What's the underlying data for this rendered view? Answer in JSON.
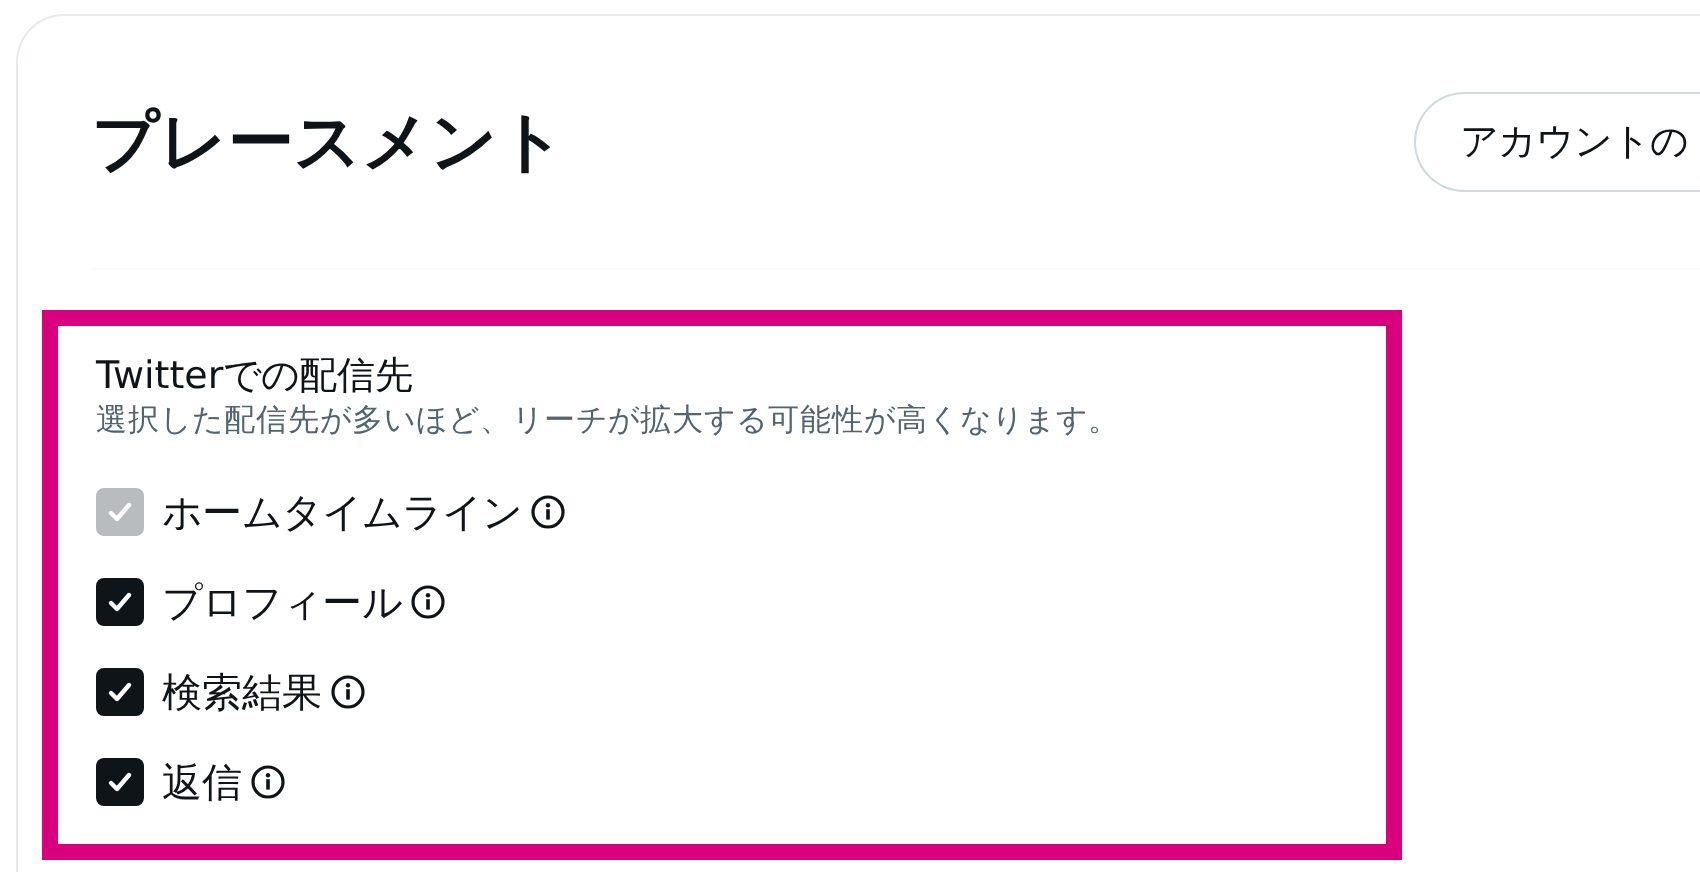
{
  "title": "プレースメント",
  "account_button": {
    "label": "アカウントの"
  },
  "placements": {
    "heading": "Twitterでの配信先",
    "description": "選択した配信先が多いほど、リーチが拡大する可能性が高くなります。",
    "options": [
      {
        "label": "ホームタイムライン",
        "checked": true,
        "disabled": true
      },
      {
        "label": "プロフィール",
        "checked": true,
        "disabled": false
      },
      {
        "label": "検索結果",
        "checked": true,
        "disabled": false
      },
      {
        "label": "返信",
        "checked": true,
        "disabled": false
      }
    ]
  }
}
